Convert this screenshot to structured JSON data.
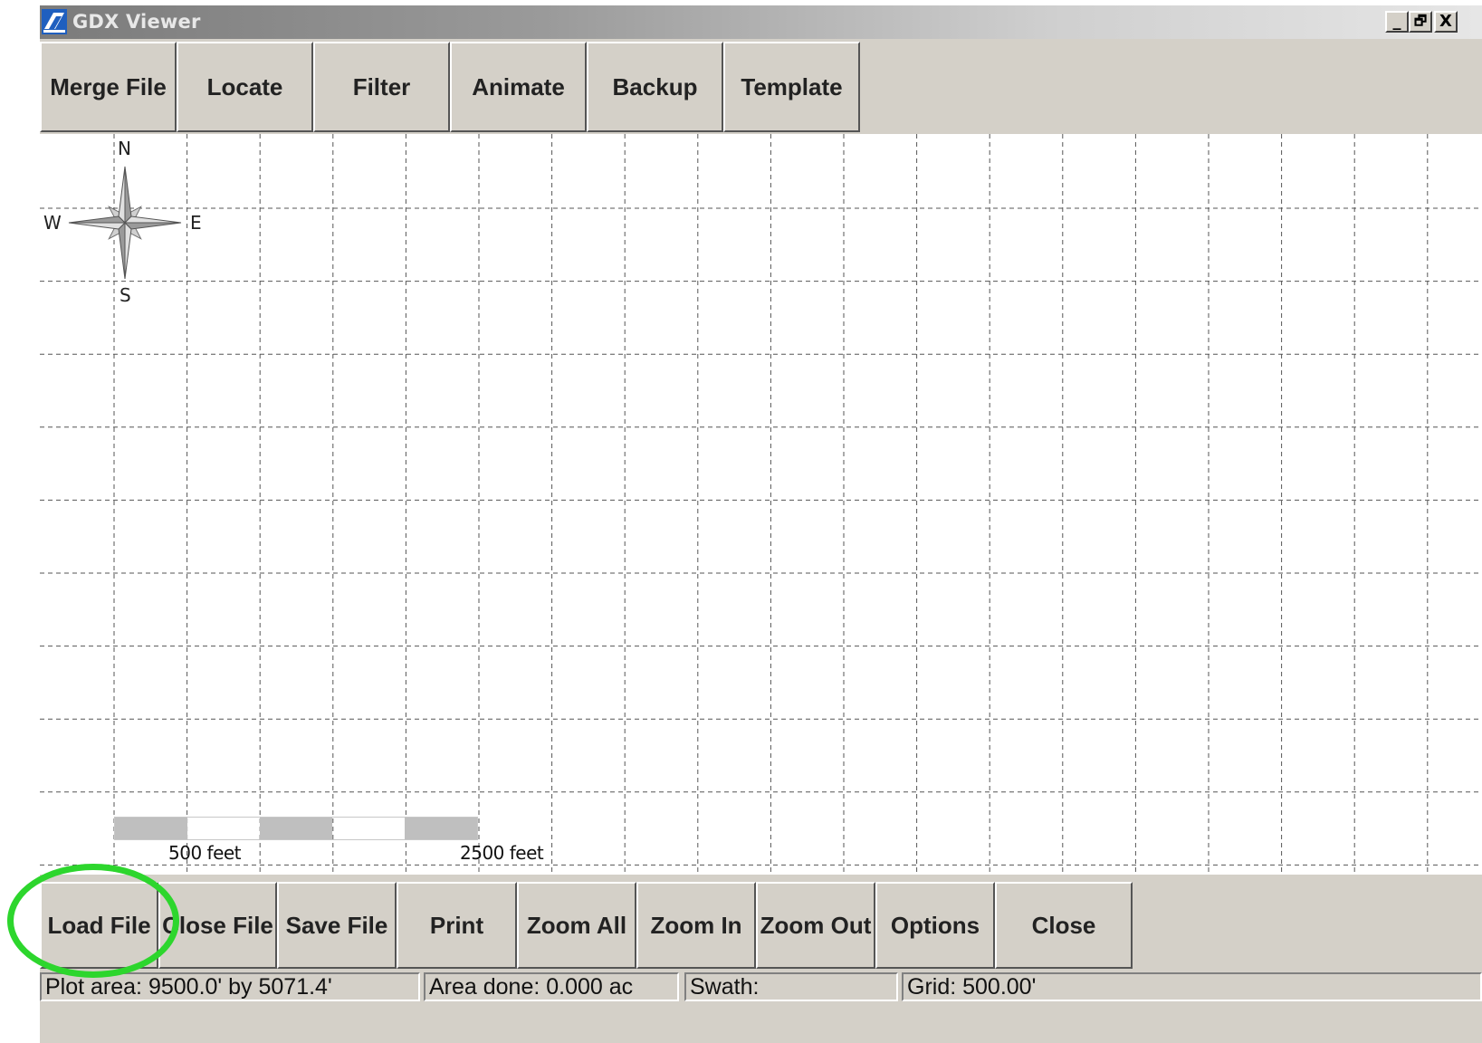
{
  "window": {
    "title": "GDX Viewer",
    "controls": {
      "minimize": "_",
      "restore": "🗗",
      "close": "X"
    }
  },
  "top_toolbar": {
    "buttons": [
      "Merge File",
      "Locate",
      "Filter",
      "Animate",
      "Backup",
      "Template"
    ]
  },
  "plot": {
    "compass": {
      "north": "N",
      "south": "S",
      "east": "E",
      "west": "W"
    },
    "scale_bar": {
      "label_small": "500 feet",
      "label_large": "2500 feet"
    }
  },
  "bottom_toolbar": {
    "buttons": [
      "Load File",
      "Close File",
      "Save File",
      "Print",
      "Zoom All",
      "Zoom In",
      "Zoom Out",
      "Options",
      "Close"
    ]
  },
  "status_bar": {
    "plot_area": "Plot area: 9500.0' by 5071.4'",
    "area_done": "Area done: 0.000 ac",
    "swath": "Swath:",
    "grid": "Grid: 500.00'"
  },
  "colors": {
    "highlight": "#2dd62d",
    "scale_fill": "#bfbfbf",
    "face": "#d4d0c8"
  }
}
